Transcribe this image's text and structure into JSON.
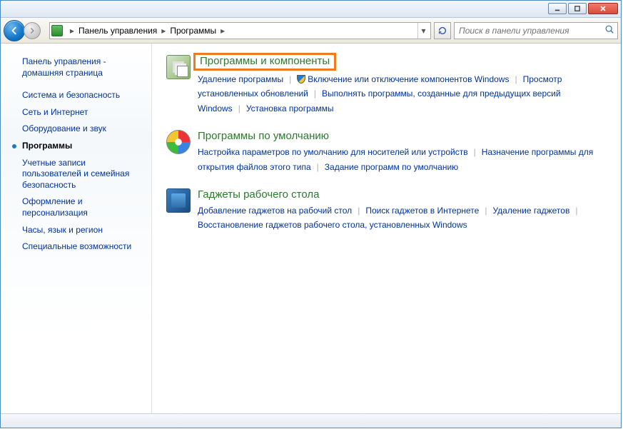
{
  "breadcrumb": {
    "root_sep": "▸",
    "item1": "Панель управления",
    "item2": "Программы"
  },
  "search": {
    "placeholder": "Поиск в панели управления"
  },
  "sidebar": {
    "head": "Панель управления - домашняя страница",
    "items": [
      "Система и безопасность",
      "Сеть и Интернет",
      "Оборудование и звук",
      "Программы",
      "Учетные записи пользователей и семейная безопасность",
      "Оформление и персонализация",
      "Часы, язык и регион",
      "Специальные возможности"
    ],
    "active_index": 3
  },
  "sections": [
    {
      "title": "Программы и компоненты",
      "highlight": true,
      "links": [
        {
          "text": "Удаление программы"
        },
        {
          "text": "Включение или отключение компонентов Windows",
          "shield": true
        },
        {
          "text": "Просмотр установленных обновлений"
        },
        {
          "text": "Выполнять программы, созданные для предыдущих версий Windows"
        },
        {
          "text": "Установка программы"
        }
      ]
    },
    {
      "title": "Программы по умолчанию",
      "links": [
        {
          "text": "Настройка параметров по умолчанию для носителей или устройств"
        },
        {
          "text": "Назначение программы для открытия файлов этого типа"
        },
        {
          "text": "Задание программ по умолчанию"
        }
      ]
    },
    {
      "title": "Гаджеты рабочего стола",
      "links": [
        {
          "text": "Добавление гаджетов на рабочий стол"
        },
        {
          "text": "Поиск гаджетов в Интернете"
        },
        {
          "text": "Удаление гаджетов"
        },
        {
          "text": "Восстановление гаджетов рабочего стола, установленных Windows"
        }
      ]
    }
  ]
}
